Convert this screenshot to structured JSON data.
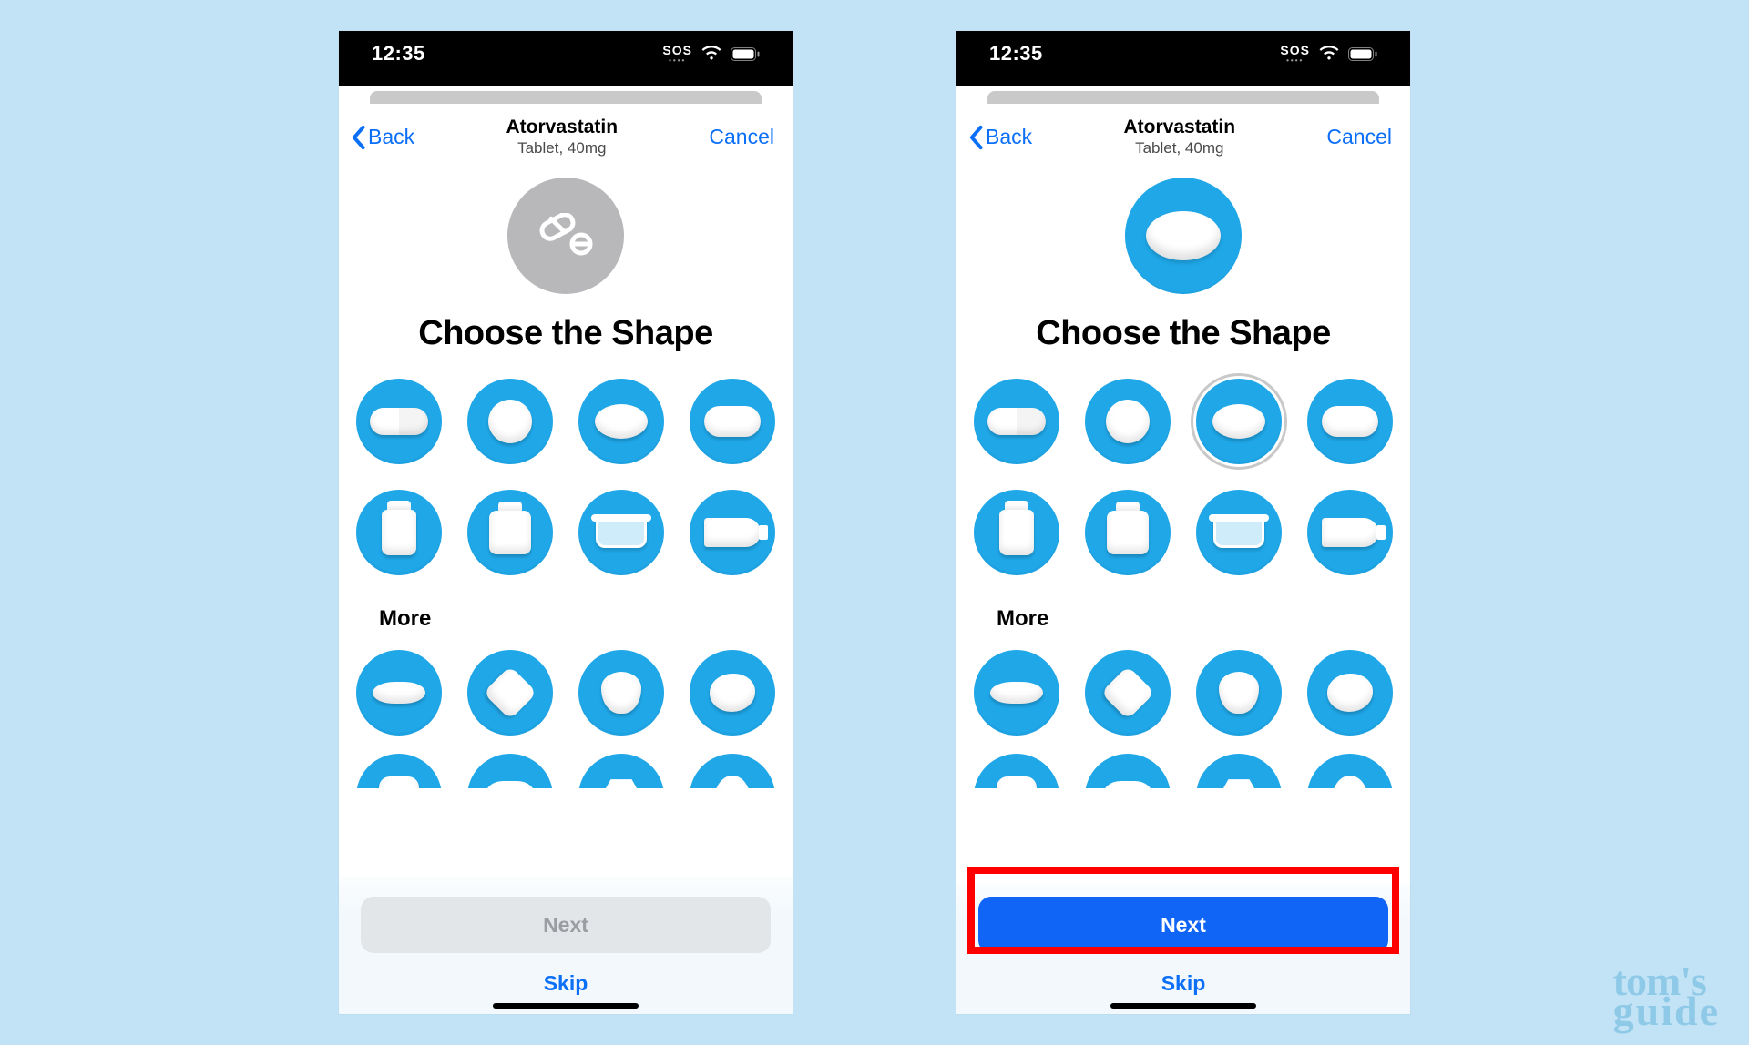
{
  "statusbar": {
    "time": "12:35",
    "sos": "SOS"
  },
  "nav": {
    "back": "Back",
    "title": "Atorvastatin",
    "subtitle": "Tablet, 40mg",
    "cancel": "Cancel"
  },
  "heading": "Choose the Shape",
  "more_label": "More",
  "footer": {
    "next": "Next",
    "skip": "Skip"
  },
  "watermark": {
    "line1": "tom's",
    "line2": "guide"
  },
  "shapes_row1": [
    "capsule",
    "round",
    "oval",
    "oblong"
  ],
  "shapes_row2": [
    "bottle-narrow",
    "bottle-wide",
    "cup",
    "tube"
  ],
  "shapes_more1": [
    "diamond-flat",
    "diamond",
    "shield",
    "pebble"
  ],
  "shapes_more2": [
    "rounded-square",
    "lozenge",
    "hexagon",
    "drop"
  ],
  "left_screen": {
    "selected_shape": null,
    "next_enabled": false
  },
  "right_screen": {
    "selected_shape": "oval",
    "next_enabled": true,
    "highlight_next": true
  }
}
